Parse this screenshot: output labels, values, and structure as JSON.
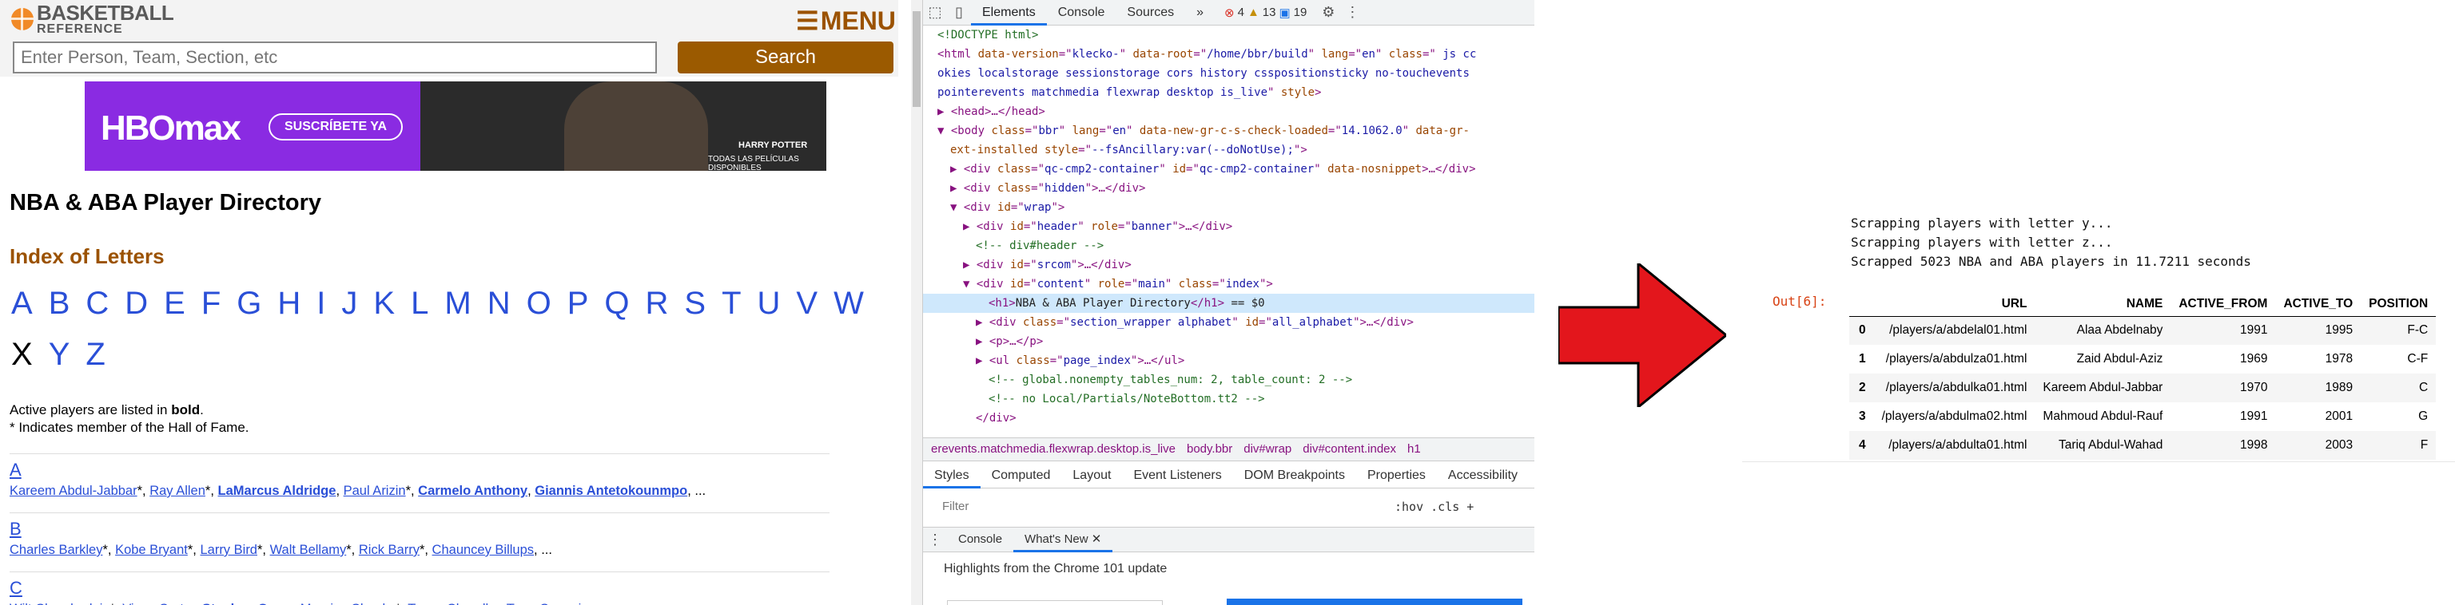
{
  "site": {
    "logo_line1": "BASKETBALL",
    "logo_line2": "REFERENCE",
    "menu_label": "MENU",
    "search_placeholder": "Enter Person, Team, Section, etc",
    "search_button": "Search",
    "banner_brand": "HBOmax",
    "banner_cta": "SUSCRÍBETE YA",
    "banner_movie": "HARRY POTTER",
    "banner_tagline": "TODAS LAS PELÍCULAS DISPONIBLES",
    "page_title": "NBA & ABA Player Directory",
    "index_title": "Index of Letters",
    "letters_row1": [
      "A",
      "B",
      "C",
      "D",
      "E",
      "F",
      "G",
      "H",
      "I",
      "J",
      "K",
      "L",
      "M",
      "N",
      "O",
      "P",
      "Q",
      "R",
      "S",
      "T",
      "U",
      "V",
      "W"
    ],
    "letters_row2": [
      "X",
      "Y",
      "Z"
    ],
    "note_active_prefix": "Active players are listed in ",
    "note_active_bold": "bold",
    "note_active_suffix": ".",
    "note_hof": "* Indicates member of the Hall of Fame.",
    "sections": [
      {
        "letter": "A",
        "players": [
          {
            "name": "Kareem Abdul-Jabbar",
            "mark": "*",
            "bold": false
          },
          {
            "name": "Ray Allen",
            "mark": "*",
            "bold": false
          },
          {
            "name": "LaMarcus Aldridge",
            "mark": "",
            "bold": true
          },
          {
            "name": "Paul Arizin",
            "mark": "*",
            "bold": false
          },
          {
            "name": "Carmelo Anthony",
            "mark": "",
            "bold": true
          },
          {
            "name": "Giannis Antetokounmpo",
            "mark": "",
            "bold": true
          }
        ]
      },
      {
        "letter": "B",
        "players": [
          {
            "name": "Charles Barkley",
            "mark": "*",
            "bold": false
          },
          {
            "name": "Kobe Bryant",
            "mark": "*",
            "bold": false
          },
          {
            "name": "Larry Bird",
            "mark": "*",
            "bold": false
          },
          {
            "name": "Walt Bellamy",
            "mark": "*",
            "bold": false
          },
          {
            "name": "Rick Barry",
            "mark": "*",
            "bold": false
          },
          {
            "name": "Chauncey Billups",
            "mark": "",
            "bold": false
          }
        ]
      },
      {
        "letter": "C",
        "players": [
          {
            "name": "Wilt Chamberlain",
            "mark": "*",
            "bold": false
          },
          {
            "name": "Vince Carter",
            "mark": "",
            "bold": false
          },
          {
            "name": "Stephen Curry",
            "mark": "",
            "bold": true
          },
          {
            "name": "Maurice Cheeks",
            "mark": "*",
            "bold": false
          },
          {
            "name": "Tyson Chandler",
            "mark": "",
            "bold": false
          },
          {
            "name": "Terry Cummings",
            "mark": "",
            "bold": false
          }
        ]
      }
    ],
    "ellipsis": "..."
  },
  "devtools": {
    "tabs": [
      "Elements",
      "Console",
      "Sources"
    ],
    "more": "»",
    "errors": "4",
    "warnings": "13",
    "infos": "19",
    "code_lines": [
      {
        "html": "<span class='cm'>&lt;!DOCTYPE html&gt;</span>",
        "indent": 0
      },
      {
        "html": "&lt;html <span class='at'>data-version</span>=\"<span class='av'>klecko-</span>\" <span class='at'>data-root</span>=\"<span class='av'>/home/bbr/build</span>\" <span class='at'>lang</span>=\"<span class='av'>en</span>\" <span class='at'>class</span>=\" <span class='av'>js cc</span>",
        "indent": 0
      },
      {
        "html": "<span class='av'>okies localstorage sessionstorage cors history csspositionsticky no-touchevents</span>",
        "indent": 0
      },
      {
        "html": "<span class='av'>pointerevents matchmedia flexwrap desktop is_live</span>\" <span class='at'>style</span>&gt;",
        "indent": 0
      },
      {
        "html": "▶ &lt;head&gt;…&lt;/head&gt;",
        "indent": 0
      },
      {
        "html": "▼ &lt;body <span class='at'>class</span>=\"<span class='av'>bbr</span>\" <span class='at'>lang</span>=\"<span class='av'>en</span>\" <span class='at'>data-new-gr-c-s-check-loaded</span>=\"<span class='av'>14.1062.0</span>\" <span class='at'>data-gr-</span>",
        "indent": 0
      },
      {
        "html": "<span class='at'>ext-installed</span> <span class='at'>style</span>=\"<span class='av'>--fsAncillary:var(--doNotUse);</span>\"&gt;",
        "indent": 1
      },
      {
        "html": "▶ &lt;div <span class='at'>class</span>=\"<span class='av'>qc-cmp2-container</span>\" <span class='at'>id</span>=\"<span class='av'>qc-cmp2-container</span>\" <span class='at'>data-nosnippet</span>&gt;…&lt;/div&gt;",
        "indent": 1
      },
      {
        "html": "▶ &lt;div <span class='at'>class</span>=\"<span class='av'>hidden</span>\"&gt;…&lt;/div&gt;",
        "indent": 1
      },
      {
        "html": "▼ &lt;div <span class='at'>id</span>=\"<span class='av'>wrap</span>\"&gt;",
        "indent": 1
      },
      {
        "html": "▶ &lt;div <span class='at'>id</span>=\"<span class='av'>header</span>\" <span class='at'>role</span>=\"<span class='av'>banner</span>\"&gt;…&lt;/div&gt;",
        "indent": 2
      },
      {
        "html": "<span class='cm'>&lt;!-- div#header --&gt;</span>",
        "indent": 3
      },
      {
        "html": "▶ &lt;div <span class='at'>id</span>=\"<span class='av'>srcom</span>\"&gt;…&lt;/div&gt;",
        "indent": 2
      },
      {
        "html": "▼ &lt;div <span class='at'>id</span>=\"<span class='av'>content</span>\" <span class='at'>role</span>=\"<span class='av'>main</span>\" <span class='at'>class</span>=\"<span class='av'>index</span>\"&gt;",
        "indent": 2
      },
      {
        "html": "&lt;h1&gt;<span class='tx'>NBA &amp; ABA Player Directory</span>&lt;/h1&gt; <span class='tx'>== $0</span>",
        "indent": 4,
        "selected": true
      },
      {
        "html": "▶ &lt;div <span class='at'>class</span>=\"<span class='av'>section_wrapper alphabet</span>\" <span class='at'>id</span>=\"<span class='av'>all_alphabet</span>\"&gt;…&lt;/div&gt;",
        "indent": 3
      },
      {
        "html": "▶ &lt;p&gt;…&lt;/p&gt;",
        "indent": 3
      },
      {
        "html": "▶ &lt;ul <span class='at'>class</span>=\"<span class='av'>page_index</span>\"&gt;…&lt;/ul&gt;",
        "indent": 3
      },
      {
        "html": "<span class='cm'>&lt;!-- global.nonempty_tables_num: 2, table_count: 2 --&gt;</span>",
        "indent": 4
      },
      {
        "html": "<span class='cm'>&lt;!-- no Local/Partials/NoteBottom.tt2 --&gt;</span>",
        "indent": 4
      },
      {
        "html": "&lt;/div&gt;",
        "indent": 3
      }
    ],
    "breadcrumbs": [
      "erevents.matchmedia.flexwrap.desktop.is_live",
      "body.bbr",
      "div#wrap",
      "div#content.index",
      "h1"
    ],
    "panel_tabs": [
      "Styles",
      "Computed",
      "Layout",
      "Event Listeners",
      "DOM Breakpoints",
      "Properties",
      "Accessibility"
    ],
    "filter_placeholder": "Filter",
    "hov_cls": ":hov  .cls  +",
    "drawer_tabs": [
      "Console",
      "What's New"
    ],
    "whats_new": "Highlights from the Chrome 101 update"
  },
  "notebook": {
    "stream_lines": [
      "Scrapping players with letter y...",
      "Scrapping players with letter z...",
      "Scrapped 5023 NBA and ABA players in 11.7211 seconds"
    ],
    "out_label": "Out[6]:",
    "columns": [
      "",
      "URL",
      "NAME",
      "ACTIVE_FROM",
      "ACTIVE_TO",
      "POSITION"
    ],
    "rows": [
      [
        "0",
        "/players/a/abdelal01.html",
        "Alaa Abdelnaby",
        "1991",
        "1995",
        "F-C"
      ],
      [
        "1",
        "/players/a/abdulza01.html",
        "Zaid Abdul-Aziz",
        "1969",
        "1978",
        "C-F"
      ],
      [
        "2",
        "/players/a/abdulka01.html",
        "Kareem Abdul-Jabbar",
        "1970",
        "1989",
        "C"
      ],
      [
        "3",
        "/players/a/abdulma02.html",
        "Mahmoud Abdul-Rauf",
        "1991",
        "2001",
        "G"
      ],
      [
        "4",
        "/players/a/abdulta01.html",
        "Tariq Abdul-Wahad",
        "1998",
        "2003",
        "F"
      ]
    ]
  },
  "arrow_color": "#e3161c",
  "accent_link": "#2a4fd7",
  "accent_brand": "#9b5200"
}
